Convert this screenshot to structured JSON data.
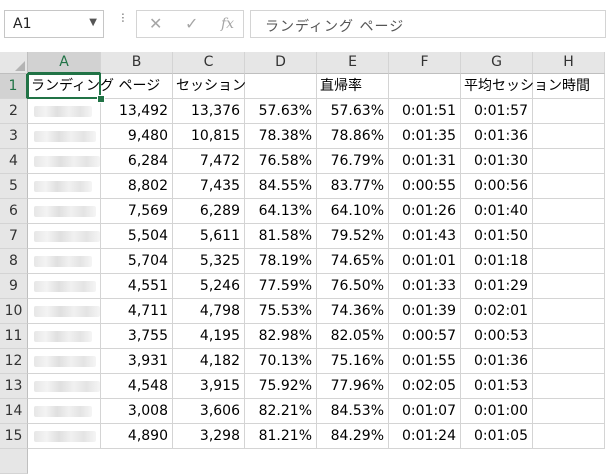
{
  "formula_bar": {
    "name_box": "A1",
    "cancel_icon": "✕",
    "enter_icon": "✓",
    "fx_label": "fx",
    "formula": "ランディング ページ"
  },
  "columns": [
    "A",
    "B",
    "C",
    "D",
    "E",
    "F",
    "G",
    "H"
  ],
  "selected_cell": "A1",
  "header_row": {
    "A": "ランディング ページ",
    "C": "セッション",
    "E": "直帰率",
    "G": "平均セッション時間"
  },
  "rows": [
    {
      "n": "2",
      "B": "13,492",
      "C": "13,376",
      "D": "57.63%",
      "E": "57.63%",
      "F": "0:01:51",
      "G": "0:01:57"
    },
    {
      "n": "3",
      "B": "9,480",
      "C": "10,815",
      "D": "78.38%",
      "E": "78.86%",
      "F": "0:01:35",
      "G": "0:01:36"
    },
    {
      "n": "4",
      "B": "6,284",
      "C": "7,472",
      "D": "76.58%",
      "E": "76.79%",
      "F": "0:01:31",
      "G": "0:01:30"
    },
    {
      "n": "5",
      "B": "8,802",
      "C": "7,435",
      "D": "84.55%",
      "E": "83.77%",
      "F": "0:00:55",
      "G": "0:00:56"
    },
    {
      "n": "6",
      "B": "7,569",
      "C": "6,289",
      "D": "64.13%",
      "E": "64.10%",
      "F": "0:01:26",
      "G": "0:01:40"
    },
    {
      "n": "7",
      "B": "5,504",
      "C": "5,611",
      "D": "81.58%",
      "E": "79.52%",
      "F": "0:01:43",
      "G": "0:01:50"
    },
    {
      "n": "8",
      "B": "5,704",
      "C": "5,325",
      "D": "78.19%",
      "E": "74.65%",
      "F": "0:01:01",
      "G": "0:01:18"
    },
    {
      "n": "9",
      "B": "4,551",
      "C": "5,246",
      "D": "77.59%",
      "E": "76.50%",
      "F": "0:01:33",
      "G": "0:01:29"
    },
    {
      "n": "10",
      "B": "4,711",
      "C": "4,798",
      "D": "75.53%",
      "E": "74.36%",
      "F": "0:01:39",
      "G": "0:02:01"
    },
    {
      "n": "11",
      "B": "3,755",
      "C": "4,195",
      "D": "82.98%",
      "E": "82.05%",
      "F": "0:00:57",
      "G": "0:00:53"
    },
    {
      "n": "12",
      "B": "3,931",
      "C": "4,182",
      "D": "70.13%",
      "E": "75.16%",
      "F": "0:01:55",
      "G": "0:01:36"
    },
    {
      "n": "13",
      "B": "4,548",
      "C": "3,915",
      "D": "75.92%",
      "E": "77.96%",
      "F": "0:02:05",
      "G": "0:01:53"
    },
    {
      "n": "14",
      "B": "3,008",
      "C": "3,606",
      "D": "82.21%",
      "E": "84.53%",
      "F": "0:01:07",
      "G": "0:01:00"
    },
    {
      "n": "15",
      "B": "4,890",
      "C": "3,298",
      "D": "81.21%",
      "E": "84.29%",
      "F": "0:01:24",
      "G": "0:01:05"
    }
  ],
  "colors": {
    "selection": "#217346",
    "header_bg": "#e6e6e6",
    "gridline": "#d4d4d4"
  }
}
